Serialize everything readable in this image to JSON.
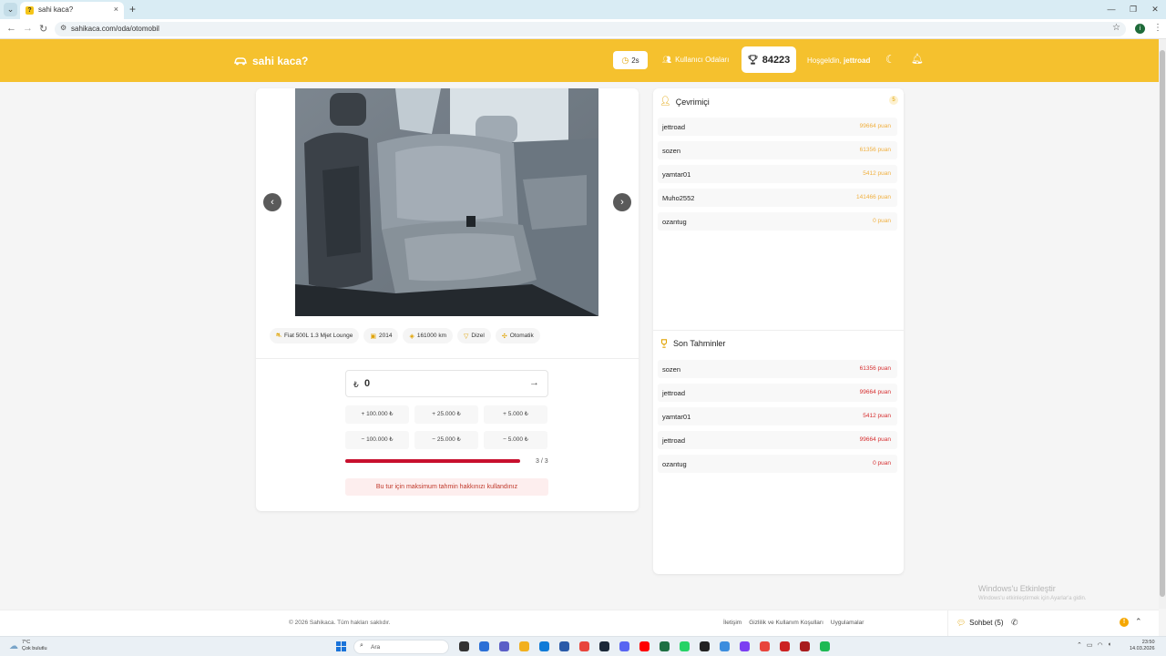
{
  "browser": {
    "tab_title": "sahi kaca?",
    "tab_favicon": "?",
    "tab_close": "×",
    "new_tab": "+",
    "url": "sahikaca.com/oda/otomobil",
    "profile_initial": "i",
    "window_controls": [
      "—",
      "❐",
      "✕"
    ]
  },
  "header": {
    "logo_text": "sahi kaca?",
    "timer": "2s",
    "rooms_label": "Kullanıcı Odaları",
    "score": "84223",
    "welcome_prefix": "Hoşgeldin,",
    "username": "jettroad",
    "brand_color": "#f5c12e"
  },
  "car": {
    "chips": [
      {
        "icon": "car-icon",
        "label": "Fiat 500L 1.3 Mjet Lounge"
      },
      {
        "icon": "calendar-icon",
        "label": "2014"
      },
      {
        "icon": "gauge-icon",
        "label": "161000 km"
      },
      {
        "icon": "fuel-icon",
        "label": "Dizel"
      },
      {
        "icon": "gear-icon",
        "label": "Otomatik"
      }
    ]
  },
  "guess": {
    "currency": "₺",
    "value": "0",
    "plus_buttons": [
      "+ 100.000 ₺",
      "+ 25.000 ₺",
      "+ 5.000 ₺"
    ],
    "minus_buttons": [
      "− 100.000 ₺",
      "− 25.000 ₺",
      "− 5.000 ₺"
    ],
    "progress_text": "3 / 3",
    "progress_fraction": 1.0,
    "progress_color": "#c8102e",
    "warning": "Bu tur için maksimum tahmin hakkınızı kullandınız"
  },
  "online": {
    "title": "Çevrimiçi",
    "count": "5",
    "users": [
      {
        "name": "jettroad",
        "points": "99664 puan"
      },
      {
        "name": "sozen",
        "points": "61356 puan"
      },
      {
        "name": "yamtar01",
        "points": "5412 puan"
      },
      {
        "name": "Muho2552",
        "points": "141466 puan"
      },
      {
        "name": "ozantug",
        "points": "0 puan"
      }
    ]
  },
  "recent": {
    "title": "Son Tahminler",
    "guesses": [
      {
        "name": "sozen",
        "points": "61356 puan"
      },
      {
        "name": "jettroad",
        "points": "99664 puan"
      },
      {
        "name": "yamtar01",
        "points": "5412 puan"
      },
      {
        "name": "jettroad",
        "points": "99664 puan"
      },
      {
        "name": "ozantug",
        "points": "0 puan"
      }
    ]
  },
  "footer": {
    "copyright": "© 2026 Sahikaca. Tüm hakları saklıdır.",
    "links": [
      "İletişim",
      "Gizlilik ve Kullanım Koşulları",
      "Uygulamalar"
    ],
    "chat_label": "Sohbet (5)",
    "chat_alert": "!"
  },
  "watermark": {
    "line1": "Windows'u Etkinleştir",
    "line2": "Windows'u etkinleştirmek için Ayarlar'a gidin."
  },
  "taskbar": {
    "temp": "7°C",
    "weather": "Çok bulutlu",
    "search_placeholder": "Ara",
    "time": "23:50",
    "date": "14.03.2026"
  }
}
